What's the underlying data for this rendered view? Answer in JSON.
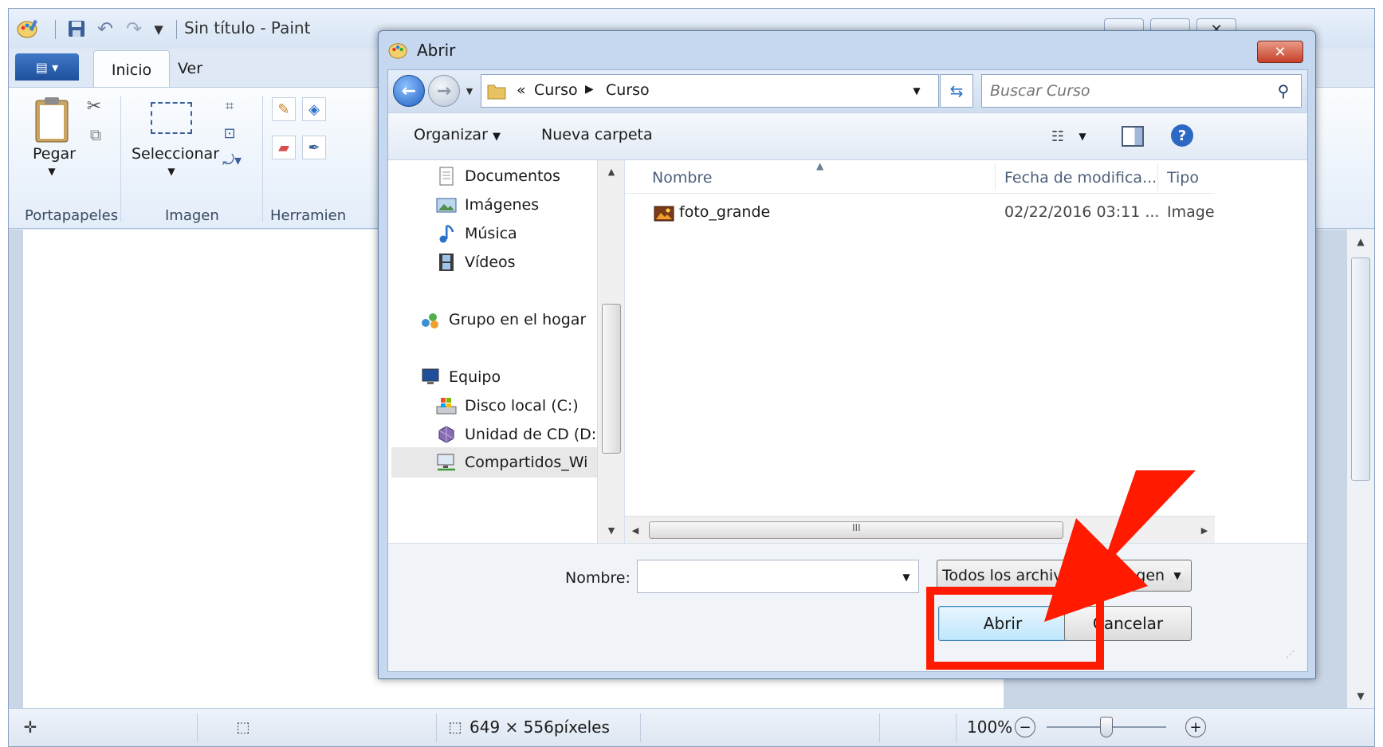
{
  "paint": {
    "title": "Sin título - Paint",
    "tabs": {
      "inicio": "Inicio",
      "ver": "Ver"
    },
    "ribbon": {
      "pegar": "Pegar",
      "seleccionar": "Seleccionar",
      "groups": {
        "portapapeles": "Portapapeles",
        "imagen": "Imagen",
        "herramientas": "Herramien"
      }
    },
    "status": {
      "dimensions": "649 × 556píxeles",
      "zoom": "100%",
      "zoom_level": 0.5
    }
  },
  "dialog": {
    "title": "Abrir",
    "breadcrumb": {
      "overflow": "«",
      "part1": "Curso",
      "part2": "Curso"
    },
    "search_placeholder": "Buscar Curso",
    "toolbar": {
      "organize": "Organizar",
      "new_folder": "Nueva carpeta"
    },
    "nav": {
      "documentos": "Documentos",
      "imagenes": "Imágenes",
      "musica": "Música",
      "videos": "Vídeos",
      "grupo": "Grupo en el hogar",
      "equipo": "Equipo",
      "disco": "Disco local (C:)",
      "cd": "Unidad de CD (D:",
      "compartidos": "Compartidos_Wi"
    },
    "columns": {
      "nombre": "Nombre",
      "fecha": "Fecha de modifica...",
      "tipo": "Tipo"
    },
    "files": [
      {
        "name": "foto_grande",
        "date": "02/22/2016 03:11 ...",
        "type": "Imagen P"
      }
    ],
    "filename_label": "Nombre:",
    "filename_value": "",
    "filetype": "Todos los archivos de imagen",
    "open_label": "Abrir",
    "cancel_label": "Cancelar"
  },
  "colors": {
    "annotation": "#ff1a00",
    "accent": "#3b7bd6"
  }
}
